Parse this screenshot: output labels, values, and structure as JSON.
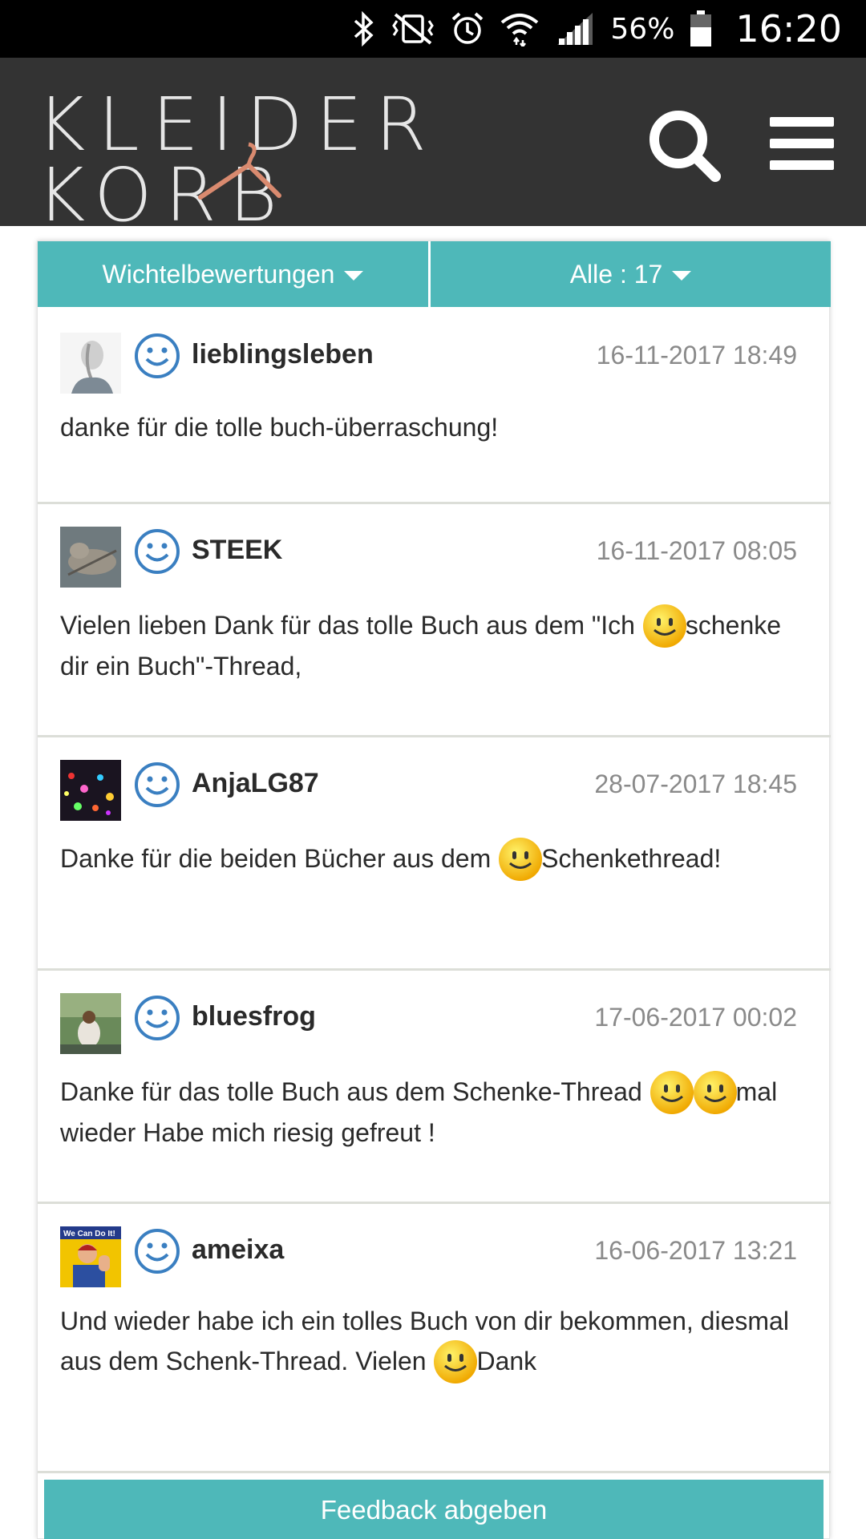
{
  "status_bar": {
    "battery_percent": "56%",
    "time": "16:20",
    "icons": [
      "bluetooth-icon",
      "vibrate-mute-icon",
      "alarm-icon",
      "wifi-icon",
      "signal-icon",
      "battery-icon"
    ]
  },
  "header": {
    "logo_line1": "KLEIDER",
    "logo_line2": "KORB",
    "search_icon": "search-icon",
    "menu_icon": "hamburger-menu-icon"
  },
  "filters": {
    "type_label": "Wichtelbewertungen",
    "count_label": "Alle : 17"
  },
  "colors": {
    "accent": "#4eb8b9",
    "header_bg": "#333333",
    "smiley_blue": "#3a7fc1",
    "date_gray": "#8a8a8a"
  },
  "reviews": [
    {
      "username": "lieblingsleben",
      "date": "16-11-2017 18:49",
      "text": "danke für die tolle buch-überraschung!",
      "emoji_count": 0
    },
    {
      "username": "STEEK",
      "date": "16-11-2017 08:05",
      "text_before": "Vielen lieben Dank für das tolle Buch aus dem \"Ich ",
      "text_after": "schenke dir ein Buch\"-Thread,",
      "emoji_count": 1
    },
    {
      "username": "AnjaLG87",
      "date": "28-07-2017 18:45",
      "text_before": "Danke für die beiden Bücher aus dem ",
      "text_after": "Schenkethread!",
      "emoji_count": 1
    },
    {
      "username": "bluesfrog",
      "date": "17-06-2017 00:02",
      "text_before": "Danke für das tolle Buch aus dem Schenke-Thread ",
      "text_after": "mal wieder Habe mich riesig gefreut !",
      "emoji_count": 2
    },
    {
      "username": "ameixa",
      "date": "16-06-2017 13:21",
      "text_before": "Und wieder habe ich ein tolles Buch von dir bekommen, diesmal aus dem Schenk-Thread. Vielen ",
      "text_after": "Dank",
      "emoji_count": 1
    }
  ],
  "avatar_badge_text": "We Can Do It!",
  "feedback_button": "Feedback abgeben"
}
